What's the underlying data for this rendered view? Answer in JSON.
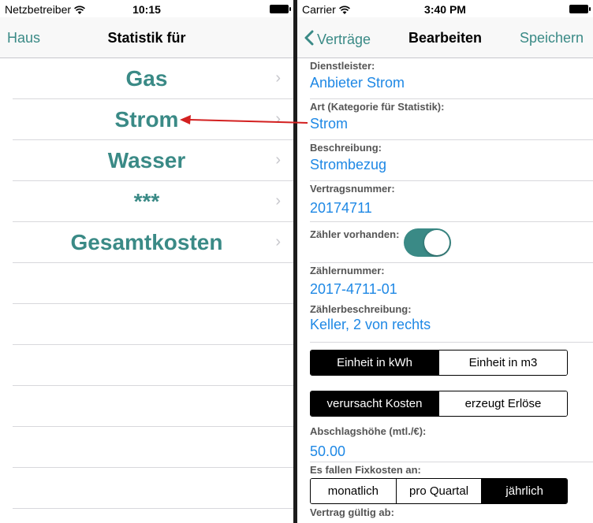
{
  "left": {
    "status": {
      "carrier": "Netzbetreiber",
      "time": "10:15"
    },
    "nav": {
      "back": "Haus",
      "title": "Statistik für"
    },
    "items": [
      {
        "label": "Gas"
      },
      {
        "label": "Strom"
      },
      {
        "label": "Wasser"
      },
      {
        "label": "***"
      },
      {
        "label": "Gesamtkosten"
      }
    ]
  },
  "right": {
    "status": {
      "carrier": "Carrier",
      "time": "3:40 PM"
    },
    "nav": {
      "back": "Verträge",
      "title": "Bearbeiten",
      "save": "Speichern"
    },
    "fields": {
      "provider": {
        "label": "Dienstleister:",
        "value": "Anbieter Strom"
      },
      "category": {
        "label": "Art (Kategorie für Statistik):",
        "value": "Strom"
      },
      "description": {
        "label": "Beschreibung:",
        "value": "Strombezug"
      },
      "contract_number": {
        "label": "Vertragsnummer:",
        "value": "20174711"
      },
      "meter_present": {
        "label": "Zähler vorhanden:",
        "on": true
      },
      "meter_number": {
        "label": "Zählernummer:",
        "value": "2017-4711-01"
      },
      "meter_description": {
        "label": "Zählerbeschreibung:",
        "value": "Keller, 2 von rechts"
      },
      "installment": {
        "label": "Abschlagshöhe (mtl./€):",
        "value": "50.00"
      },
      "fixed_costs": {
        "label": "Es fallen Fixkosten an:"
      },
      "valid_from": {
        "label": "Vertrag gültig ab:"
      }
    },
    "unit_segment": {
      "options": [
        "Einheit in kWh",
        "Einheit in m3"
      ],
      "selected": "Einheit in kWh"
    },
    "cost_segment": {
      "options": [
        "verursacht Kosten",
        "erzeugt Erlöse"
      ],
      "selected": "verursacht Kosten"
    },
    "interval_segment": {
      "options": [
        "monatlich",
        "pro Quartal",
        "jährlich"
      ],
      "selected": "jährlich"
    }
  },
  "colors": {
    "accent": "#3a8a86",
    "link": "#1e88e5",
    "arrow": "#d32020"
  }
}
